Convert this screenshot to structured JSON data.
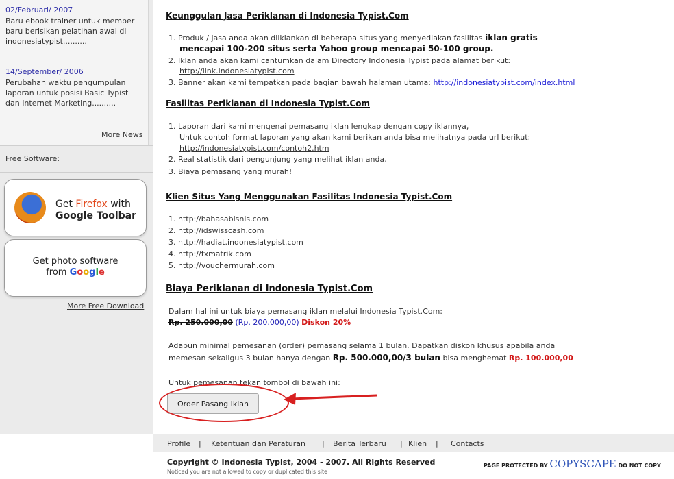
{
  "sidebar": {
    "news": [
      {
        "date": "02/Februari/ 2007",
        "text_lines": [
          "Baru ebook trainer untuk member",
          "baru berisikan pelatihan awal di",
          "indonesiatypist.........."
        ]
      },
      {
        "date": "14/September/ 2006",
        "text_lines": [
          "Perubahan waktu pengumpulan",
          "laporan untuk posisi Basic Typist",
          "dan Internet Marketing.........."
        ]
      }
    ],
    "more_news": "More News",
    "free_software_label": "Free Software:",
    "firefox_promo": {
      "get": "Get ",
      "firefox": "Firefox",
      "with": " with",
      "toolbar": "Google Toolbar",
      "icon": "firefox-icon"
    },
    "photo_promo": {
      "line1": "Get photo software",
      "line2_prefix": "from ",
      "google_letters": [
        "G",
        "o",
        "o",
        "g",
        "l",
        "e"
      ]
    },
    "more_free_download": "More Free Download"
  },
  "main": {
    "section1": {
      "title": "Keunggulan Jasa Periklanan di Indonesia Typist.Com",
      "item1_text": "1. Produk / jasa anda akan diiklankan di beberapa situs yang menyediakan fasilitas ",
      "item1_bold": "iklan gratis",
      "item1_cont": "mencapai 100-200 situs serta Yahoo group mencapai 50-100 group.",
      "item2_text": "2. Iklan anda akan kami cantumkan dalam Directory Indonesia Typist pada alamat berikut:",
      "item2_link": "http://link.indonesiatypist.com",
      "item3_text": "3. Banner akan kami tempatkan pada bagian bawah halaman utama: ",
      "item3_link": "http://indonesiatypist.com/index.html"
    },
    "section2": {
      "title": "Fasilitas Periklanan di Indonesia Typist.Com",
      "item1_text": "1. Laporan dari kami mengenai pemasang iklan lengkap dengan copy iklannya,",
      "item1_cont": "Untuk contoh format laporan yang akan kami berikan anda bisa melihatnya pada url berikut:",
      "item1_link": "http://indonesiatypist.com/contoh2.htm",
      "item2_text": "2. Real statistik dari pengunjung yang melihat iklan anda,",
      "item3_text": "3. Biaya pemasang yang murah!"
    },
    "section3": {
      "title": "Klien Situs Yang Menggunakan Fasilitas Indonesia Typist.Com",
      "clients": [
        "1. http://bahasabisnis.com",
        "2. http://idswisscash.com",
        "3. http://hadiat.indonesiatypist.com",
        "4. http://fxmatrik.com",
        "5. http://vouchermurah.com"
      ]
    },
    "section4": {
      "title": "Biaya Periklanan di Indonesia Typist.Com",
      "intro": "Dalam hal ini untuk biaya pemasang iklan melalui Indonesia Typist.Com:",
      "old_price": "Rp. 250.000,00",
      "new_price": "(Rp. 200.000,00)",
      "discount": "Diskon 20%",
      "minimal_line1": "Adapun minimal pemesanan (order) pemasang selama 1 bulan. Dapatkan diskon khusus apabila anda",
      "minimal_line2_prefix": "memesan sekaligus 3 bulan hanya dengan ",
      "minimal_line2_bold": "Rp. 500.000,00/3 bulan",
      "minimal_line2_mid": " bisa menghemat ",
      "minimal_line2_red": "Rp. 100.000,00",
      "order_instruction": "Untuk pemesanan tekan tombol di bawah ini:",
      "order_button": "Order Pasang Iklan"
    }
  },
  "footer": {
    "nav": [
      "Profile",
      "|",
      "Ketentuan dan Peraturan",
      "|",
      "Berita Terbaru",
      "|",
      "Klien",
      "|",
      "Contacts"
    ],
    "copyright": "Copyright © Indonesia Typist, 2004 - 2007. All Rights Reserved",
    "notice": "Noticed you are not allowed to copy or duplicated this site",
    "copyscape_prefix": "PAGE PROTECTED BY ",
    "copyscape_logo": "COPYSCAPE",
    "copyscape_suffix": " DO NOT COPY"
  },
  "colors": {
    "annotation_red": "#d82020",
    "link_blue": "#1a1ad6",
    "sidebar_bg": "#ebebeb"
  }
}
